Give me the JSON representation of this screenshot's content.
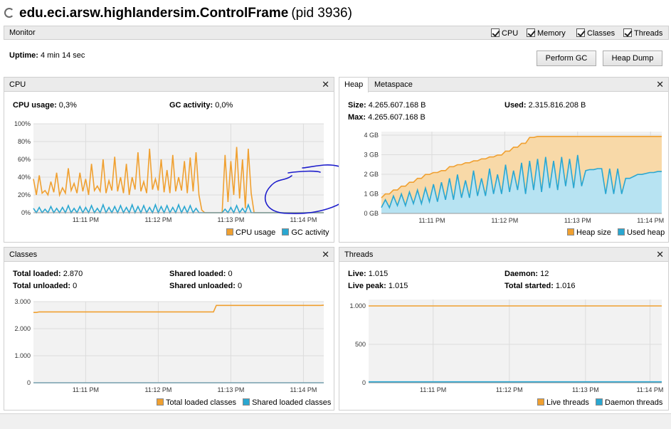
{
  "window": {
    "app_name": "edu.eci.arsw.highlandersim.ControlFrame",
    "pid": "(pid 3936)"
  },
  "monitor": {
    "label": "Monitor",
    "checkboxes": [
      {
        "label": "CPU",
        "checked": true
      },
      {
        "label": "Memory",
        "checked": true
      },
      {
        "label": "Classes",
        "checked": true
      },
      {
        "label": "Threads",
        "checked": true
      }
    ],
    "uptime_label": "Uptime:",
    "uptime_value": " 4 min 14 sec",
    "perform_gc": "Perform GC",
    "heap_dump": "Heap Dump"
  },
  "colors": {
    "orange": "#f0a030",
    "orange_fill": "#f8d9a8",
    "blue": "#2aa7d1",
    "blue_fill": "#b7e3f2",
    "annotation": "#1d1dcc"
  },
  "cpu": {
    "title": "CPU",
    "cpu_usage_label": "CPU usage:",
    "cpu_usage_value": " 0,3%",
    "gc_activity_label": "GC activity:",
    "gc_activity_value": " 0,0%",
    "legend": [
      "CPU usage",
      "GC activity"
    ],
    "y_ticks": [
      "100%",
      "80%",
      "60%",
      "40%",
      "20%",
      "0%"
    ],
    "x_ticks": [
      "11:11 PM",
      "11:12 PM",
      "11:13 PM",
      "11:14 PM"
    ]
  },
  "heap": {
    "tab_heap": "Heap",
    "tab_metaspace": "Metaspace",
    "size_label": "Size:",
    "size_value": " 4.265.607.168 B",
    "max_label": "Max:",
    "max_value": " 4.265.607.168 B",
    "used_label": "Used:",
    "used_value": " 2.315.816.208 B",
    "legend": [
      "Heap size",
      "Used heap"
    ],
    "y_ticks": [
      "4 GB",
      "3 GB",
      "2 GB",
      "1 GB",
      "0 GB"
    ],
    "x_ticks": [
      "11:11 PM",
      "11:12 PM",
      "11:13 PM",
      "11:14 PM"
    ]
  },
  "classes": {
    "title": "Classes",
    "total_loaded_label": "Total loaded:",
    "total_loaded_value": " 2.870",
    "total_unloaded_label": "Total unloaded:",
    "total_unloaded_value": " 0",
    "shared_loaded_label": "Shared loaded:",
    "shared_loaded_value": " 0",
    "shared_unloaded_label": "Shared unloaded:",
    "shared_unloaded_value": " 0",
    "legend": [
      "Total loaded classes",
      "Shared loaded classes"
    ],
    "y_ticks": [
      "3.000",
      "2.000",
      "1.000",
      "0"
    ],
    "x_ticks": [
      "11:11 PM",
      "11:12 PM",
      "11:13 PM",
      "11:14 PM"
    ]
  },
  "threads": {
    "title": "Threads",
    "live_label": "Live:",
    "live_value": " 1.015",
    "live_peak_label": "Live peak:",
    "live_peak_value": " 1.015",
    "daemon_label": "Daemon:",
    "daemon_value": " 12",
    "total_started_label": "Total started:",
    "total_started_value": " 1.016",
    "legend": [
      "Live threads",
      "Daemon threads"
    ],
    "y_ticks": [
      "1.000",
      "500",
      "0"
    ],
    "x_ticks": [
      "11:11 PM",
      "11:12 PM",
      "11:13 PM",
      "11:14 PM"
    ]
  },
  "chart_data": [
    {
      "type": "line",
      "ylim": [
        0,
        100
      ],
      "series": [
        {
          "name": "CPU usage",
          "values": [
            38,
            20,
            42,
            22,
            25,
            20,
            35,
            23,
            45,
            20,
            28,
            22,
            50,
            25,
            33,
            22,
            45,
            24,
            38,
            20,
            55,
            25,
            30,
            24,
            60,
            22,
            36,
            25,
            63,
            24,
            40,
            22,
            55,
            20,
            40,
            26,
            68,
            24,
            35,
            22,
            72,
            26,
            38,
            25,
            60,
            23,
            48,
            22,
            65,
            24,
            40,
            25,
            58,
            22,
            62,
            24,
            68,
            20,
            3,
            0,
            0,
            0,
            0,
            0,
            0,
            0,
            65,
            12,
            58,
            20,
            74,
            16,
            60,
            5,
            72,
            22,
            0,
            0,
            0,
            0,
            0,
            0,
            0,
            0,
            0,
            0,
            0,
            0,
            0,
            0,
            0,
            0,
            0,
            0,
            0,
            0,
            0,
            0,
            0,
            0,
            0
          ]
        },
        {
          "name": "GC activity",
          "values": [
            5,
            0,
            6,
            0,
            4,
            0,
            7,
            0,
            5,
            0,
            6,
            0,
            8,
            0,
            5,
            0,
            7,
            0,
            6,
            0,
            8,
            0,
            5,
            0,
            9,
            0,
            6,
            0,
            7,
            0,
            8,
            0,
            6,
            0,
            9,
            0,
            7,
            0,
            8,
            0,
            6,
            0,
            9,
            0,
            7,
            0,
            8,
            0,
            6,
            0,
            9,
            0,
            7,
            0,
            8,
            0,
            5,
            0,
            0,
            0,
            0,
            0,
            0,
            0,
            0,
            0,
            4,
            0,
            6,
            0,
            8,
            0,
            5,
            0,
            9,
            0,
            0,
            0,
            0,
            0,
            0,
            0,
            0,
            0,
            0,
            0,
            0,
            0,
            0,
            0,
            0,
            0,
            0,
            0,
            0,
            0,
            0,
            0,
            0,
            0,
            0
          ]
        }
      ]
    },
    {
      "type": "area",
      "ylim": [
        0,
        4.2
      ],
      "series": [
        {
          "name": "Heap size",
          "values": [
            0.8,
            1.0,
            1.0,
            1.2,
            1.2,
            1.4,
            1.4,
            1.6,
            1.6,
            1.8,
            1.8,
            2.0,
            2.0,
            2.1,
            2.1,
            2.2,
            2.2,
            2.4,
            2.4,
            2.5,
            2.5,
            2.6,
            2.6,
            2.7,
            2.7,
            2.8,
            2.8,
            2.9,
            2.9,
            3.0,
            3.0,
            3.2,
            3.2,
            3.4,
            3.4,
            3.6,
            3.6,
            3.9,
            3.9,
            3.95,
            3.95,
            3.95,
            3.95,
            3.95,
            3.95,
            3.95,
            3.95,
            3.95,
            3.95,
            3.95,
            3.95,
            3.95,
            3.95,
            3.95,
            3.95,
            3.95,
            3.95,
            3.95,
            3.95,
            3.95,
            3.95,
            3.95,
            3.95,
            3.95,
            3.95,
            3.95,
            3.95,
            3.95,
            3.95,
            3.95,
            3.95
          ]
        },
        {
          "name": "Used heap",
          "values": [
            0.3,
            0.7,
            0.3,
            0.9,
            0.4,
            1.0,
            0.4,
            1.1,
            0.5,
            1.2,
            0.5,
            1.3,
            0.6,
            1.5,
            0.6,
            1.6,
            0.7,
            1.8,
            0.7,
            2.0,
            0.8,
            1.7,
            0.8,
            2.2,
            0.9,
            1.8,
            0.9,
            2.3,
            1.0,
            2.0,
            1.0,
            2.5,
            1.1,
            2.2,
            1.2,
            2.6,
            1.0,
            2.7,
            1.2,
            2.8,
            1.1,
            2.9,
            1.3,
            2.7,
            1.2,
            2.9,
            1.4,
            2.8,
            1.3,
            3.0,
            1.4,
            2.2,
            2.25,
            2.25,
            2.3,
            2.3,
            1.0,
            2.3,
            1.0,
            2.3,
            1.0,
            1.8,
            1.8,
            1.9,
            2.0,
            2.0,
            2.05,
            2.1,
            2.1,
            2.15,
            2.15
          ]
        }
      ]
    },
    {
      "type": "line",
      "ylim": [
        0,
        3000
      ],
      "series": [
        {
          "name": "Total loaded classes",
          "values": [
            2600,
            2600,
            2620,
            2620,
            2620,
            2620,
            2620,
            2620,
            2620,
            2620,
            2620,
            2620,
            2620,
            2620,
            2620,
            2620,
            2620,
            2620,
            2620,
            2620,
            2620,
            2620,
            2620,
            2620,
            2620,
            2620,
            2620,
            2620,
            2620,
            2620,
            2620,
            2620,
            2620,
            2620,
            2620,
            2620,
            2620,
            2620,
            2620,
            2620,
            2620,
            2620,
            2620,
            2620,
            2620,
            2620,
            2620,
            2620,
            2620,
            2620,
            2620,
            2620,
            2620,
            2620,
            2620,
            2620,
            2620,
            2620,
            2620,
            2620,
            2620,
            2620,
            2620,
            2860,
            2860,
            2860,
            2860,
            2860,
            2860,
            2860,
            2860,
            2860,
            2860,
            2860,
            2860,
            2860,
            2860,
            2860,
            2860,
            2860,
            2860,
            2860,
            2860,
            2860,
            2860,
            2860,
            2860,
            2860,
            2860,
            2860,
            2860,
            2860,
            2860,
            2860,
            2860,
            2860,
            2860,
            2860,
            2860,
            2860,
            2870
          ]
        },
        {
          "name": "Shared loaded classes",
          "values": [
            0,
            0,
            0,
            0,
            0,
            0,
            0,
            0,
            0,
            0,
            0,
            0,
            0,
            0,
            0,
            0,
            0,
            0,
            0,
            0,
            0,
            0,
            0,
            0,
            0,
            0,
            0,
            0,
            0,
            0,
            0,
            0,
            0,
            0,
            0,
            0,
            0,
            0,
            0,
            0,
            0,
            0,
            0,
            0,
            0,
            0,
            0,
            0,
            0,
            0,
            0,
            0,
            0,
            0,
            0,
            0,
            0,
            0,
            0,
            0,
            0,
            0,
            0,
            0,
            0,
            0,
            0,
            0,
            0,
            0,
            0,
            0,
            0,
            0,
            0,
            0,
            0,
            0,
            0,
            0,
            0,
            0,
            0,
            0,
            0,
            0,
            0,
            0,
            0,
            0,
            0,
            0,
            0,
            0,
            0,
            0,
            0,
            0,
            0,
            0,
            0
          ]
        }
      ]
    },
    {
      "type": "line",
      "ylim": [
        0,
        1100
      ],
      "series": [
        {
          "name": "Live threads",
          "values": [
            1015,
            1015,
            1015,
            1015,
            1015,
            1015,
            1015,
            1015,
            1015,
            1015,
            1015
          ]
        },
        {
          "name": "Daemon threads",
          "values": [
            12,
            12,
            12,
            12,
            12,
            12,
            12,
            12,
            12,
            12,
            12
          ]
        }
      ]
    }
  ]
}
